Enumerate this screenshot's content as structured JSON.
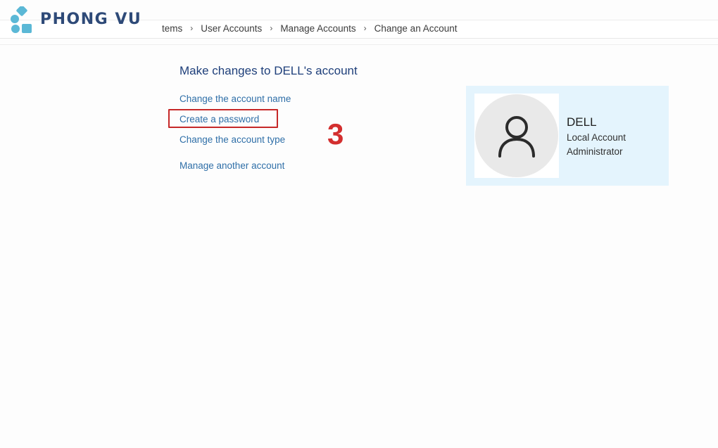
{
  "logo": {
    "text": "PHONG VU",
    "color": "#2e4a78",
    "mark_color": "#5bb8d6"
  },
  "breadcrumb": [
    "tems",
    "User Accounts",
    "Manage Accounts",
    "Change an Account"
  ],
  "breadcrumb_separator": "›",
  "main": {
    "title": "Make changes to DELL's account",
    "links": [
      "Change the account name",
      "Create a password",
      "Change the account type",
      "Manage another account"
    ],
    "highlighted_link": "Create a password",
    "step_label": "3"
  },
  "account": {
    "name": "DELL",
    "type": "Local Account",
    "role": "Administrator",
    "avatar_icon": "user-silhouette-icon"
  },
  "colors": {
    "title": "#1e3f7a",
    "link": "#2f6fa8",
    "highlight": "#c62828",
    "card_background": "#e4f4fd"
  }
}
